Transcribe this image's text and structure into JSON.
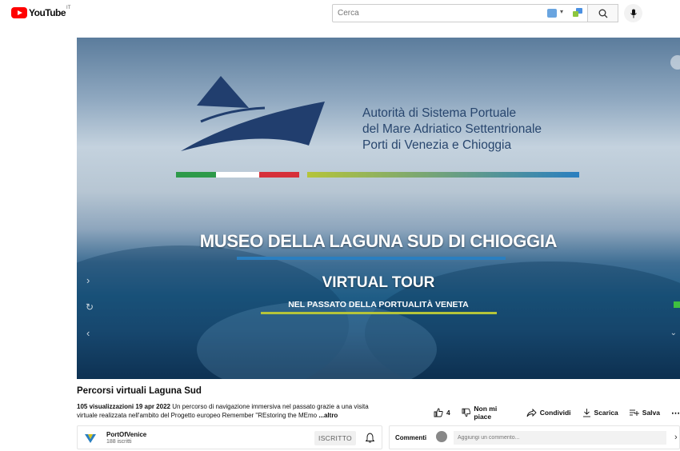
{
  "app": {
    "logo": "YouTube",
    "country_code": "IT"
  },
  "search": {
    "placeholder": "Cerca",
    "value": ""
  },
  "video": {
    "org_lines": [
      "Autorità di Sistema Portuale",
      "del Mare Adriatico Settentrionale",
      "Porti di Venezia e Chioggia"
    ],
    "big_title": "MUSEO DELLA LAGUNA SUD DI CHIOGGIA",
    "virtual_tour": "VIRTUAL TOUR",
    "subtitle": "NEL PASSATO DELLA PORTUALITÀ VENETA",
    "title": "Percorsi virtuali Laguna Sud"
  },
  "meta": {
    "views": "105 visualizzazioni",
    "date": "19 apr 2022",
    "description": "Un percorso di navigazione immersiva nel passato grazie a una visita virtuale realizzata nell'ambito del Progetto europeo Remember \"REstoring the MEmo",
    "more": "...altro"
  },
  "actions": {
    "likes": "4",
    "dislike": "Non mi piace",
    "share": "Condividi",
    "download": "Scarica",
    "save": "Salva"
  },
  "channel": {
    "name": "PortOfVenice",
    "subscribers": "188 iscritti",
    "subscribed_label": "ISCRITTO"
  },
  "comments": {
    "label": "Commenti",
    "placeholder": "Aggiungi un commento..."
  },
  "colors": {
    "brand_red": "#ff0000",
    "flag_green": "#2e9a4a",
    "flag_red": "#d6303a",
    "accent_blue": "#2a7fc0",
    "accent_green": "#b5c43a"
  }
}
